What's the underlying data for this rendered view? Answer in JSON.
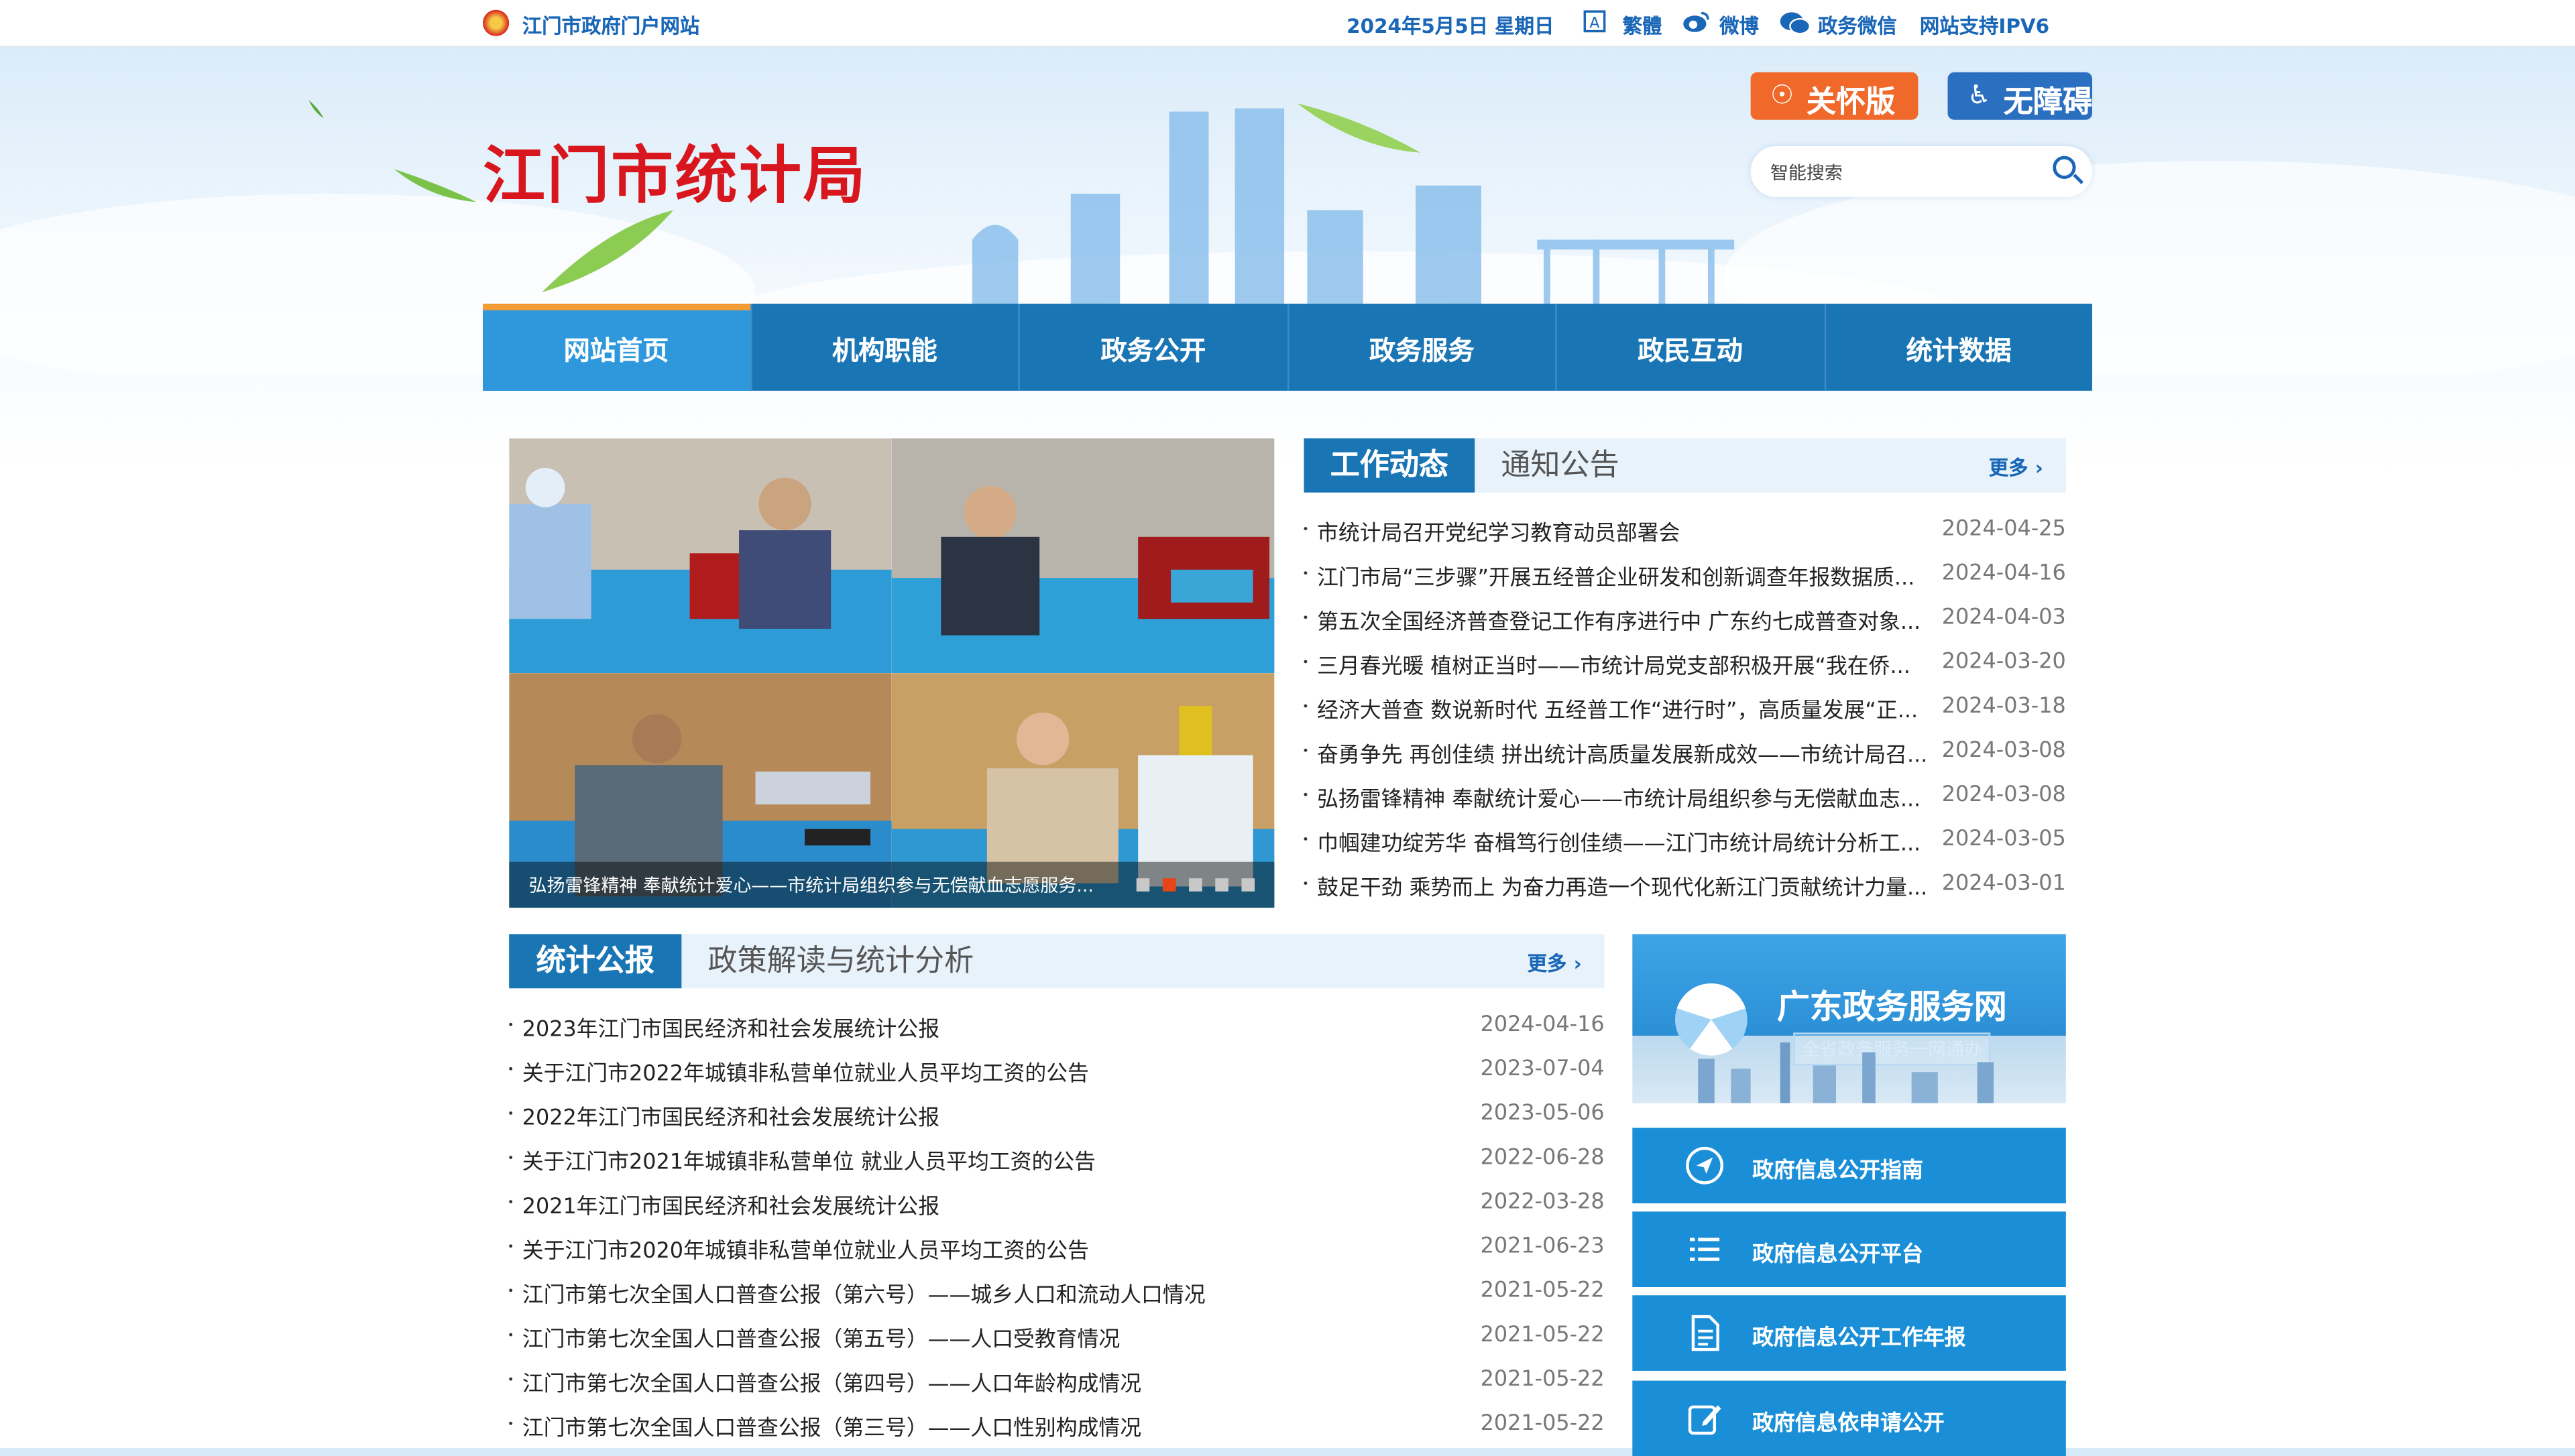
{
  "topbar": {
    "portal": "江门市政府门户网站",
    "date": "2024年5月5日 星期日",
    "traditional": "繁體",
    "weibo": "微博",
    "wechat": "政务微信",
    "ipv6": "网站支持IPV6"
  },
  "header": {
    "title": "江门市统计局",
    "care_btn": "关怀版",
    "access_btn": "无障碍",
    "search_placeholder": "智能搜索"
  },
  "nav": [
    "网站首页",
    "机构职能",
    "政务公开",
    "政务服务",
    "政民互动",
    "统计数据"
  ],
  "carousel": {
    "caption": "弘扬雷锋精神 奉献统计爱心——市统计局组织参与无偿献血志愿服务...",
    "slides": 5,
    "active_slide": 2
  },
  "news": {
    "tab_active": "工作动态",
    "tab_inactive": "通知公告",
    "more": "更多",
    "items": [
      {
        "title": "市统计局召开党纪学习教育动员部署会",
        "date": "2024-04-25"
      },
      {
        "title": "江门市局“三步骤”开展五经普企业研发和创新调查年报数据质...",
        "date": "2024-04-16"
      },
      {
        "title": "第五次全国经济普查登记工作有序进行中 广东约七成普查对象...",
        "date": "2024-04-03"
      },
      {
        "title": "三月春光暖 植树正当时——市统计局党支部积极开展“我在侨...",
        "date": "2024-03-20"
      },
      {
        "title": "经济大普查 数说新时代 五经普工作“进行时”，高质量发展“正...",
        "date": "2024-03-18"
      },
      {
        "title": "奋勇争先 再创佳绩 拼出统计高质量发展新成效——市统计局召...",
        "date": "2024-03-08"
      },
      {
        "title": "弘扬雷锋精神 奉献统计爱心——市统计局组织参与无偿献血志...",
        "date": "2024-03-08"
      },
      {
        "title": "巾帼建功绽芳华 奋楫笃行创佳绩——江门市统计局统计分析工...",
        "date": "2024-03-05"
      },
      {
        "title": "鼓足干劲 乘势而上 为奋力再造一个现代化新江门贡献统计力量...",
        "date": "2024-03-01"
      }
    ]
  },
  "bulletin": {
    "tab_active": "统计公报",
    "tab_inactive": "政策解读与统计分析",
    "more": "更多",
    "items": [
      {
        "title": "2023年江门市国民经济和社会发展统计公报",
        "date": "2024-04-16"
      },
      {
        "title": "关于江门市2022年城镇非私营单位就业人员平均工资的公告",
        "date": "2023-07-04"
      },
      {
        "title": "2022年江门市国民经济和社会发展统计公报",
        "date": "2023-05-06"
      },
      {
        "title": "关于江门市2021年城镇非私营单位 就业人员平均工资的公告",
        "date": "2022-06-28"
      },
      {
        "title": "2021年江门市国民经济和社会发展统计公报",
        "date": "2022-03-28"
      },
      {
        "title": "关于江门市2020年城镇非私营单位就业人员平均工资的公告",
        "date": "2021-06-23"
      },
      {
        "title": "江门市第七次全国人口普查公报（第六号）——城乡人口和流动人口情况",
        "date": "2021-05-22"
      },
      {
        "title": "江门市第七次全国人口普查公报（第五号）——人口受教育情况",
        "date": "2021-05-22"
      },
      {
        "title": "江门市第七次全国人口普查公报（第四号）——人口年龄构成情况",
        "date": "2021-05-22"
      },
      {
        "title": "江门市第七次全国人口普查公报（第三号）——人口性别构成情况",
        "date": "2021-05-22"
      }
    ]
  },
  "banner": {
    "title": "广东政务服务网",
    "subtitle": "全省政务服务一网通办"
  },
  "services": [
    {
      "label": "政府信息公开指南",
      "icon": "send-icon"
    },
    {
      "label": "政府信息公开平台",
      "icon": "list-icon"
    },
    {
      "label": "政府信息公开工作年报",
      "icon": "document-icon"
    },
    {
      "label": "政府信息依申请公开",
      "icon": "edit-icon"
    }
  ],
  "colors": {
    "brand_red": "#d8161d",
    "nav_blue": "#1a75b5",
    "nav_active": "#2f97dc",
    "accent_orange": "#f39c33",
    "care_orange": "#f0692a"
  }
}
